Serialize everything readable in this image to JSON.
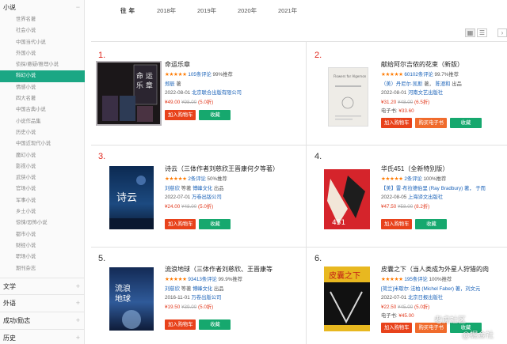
{
  "sidebar": {
    "category_open": "小说",
    "sub_items": [
      "世界名著",
      "社会小说",
      "中国当代小说",
      "外国小说",
      "侦探/悬疑/推理小说",
      "科幻小说",
      "情感小说",
      "四大名著",
      "中国古典小说",
      "小说作品集",
      "历史小说",
      "中国近现代小说",
      "魔幻小说",
      "影视小说",
      "武侠小说",
      "官场小说",
      "军事小说",
      "乡土小说",
      "惊悚/恐怖小说",
      "都市小说",
      "财经小说",
      "职场小说",
      "期刊杂志"
    ],
    "active_index": 5,
    "categories": [
      "文学",
      "外语",
      "成功/励志",
      "历史"
    ]
  },
  "years": {
    "label": "往年",
    "items": [
      "2018年",
      "2019年",
      "2020年",
      "2021年"
    ]
  },
  "view": {
    "grid_icon": "grid-view-icon",
    "list_icon": "list-view-icon"
  },
  "books": [
    {
      "rank": "1.",
      "title": "命运乐章",
      "stars": "★★★★★",
      "reviews": "105条评论",
      "recommend": "99%推荐",
      "author": "郑辰",
      "author_role": "著",
      "date": "2022-08-01",
      "publisher": "北京联合出版有限公司",
      "price": "¥49.00",
      "orig": "¥98.00",
      "discount": "(5.0折)",
      "ebook": "",
      "buttons": [
        "加入购物车",
        "",
        "收藏"
      ]
    },
    {
      "rank": "2.",
      "title": "献给阿尔吉侬的花束（新版）",
      "stars": "★★★★★",
      "reviews": "60102条评论",
      "recommend": "99.7%推荐",
      "author": "（美）丹尼尔·凯斯",
      "author_role": "著，",
      "translator": "陈澄和",
      "translator_role": "出品",
      "date": "2022-08-01",
      "publisher": "河南文艺出版社",
      "price": "¥31.20",
      "orig": "¥48.00",
      "discount": "(6.5折)",
      "ebook_label": "电子书:",
      "ebook": "¥33.60",
      "buttons": [
        "加入购物车",
        "购买电子书",
        "收藏"
      ]
    },
    {
      "rank": "3.",
      "title": "诗云（三体作者刘慈欣王晋康何夕等著）",
      "stars": "★★★★★",
      "reviews": "2条评论",
      "recommend": "50%推荐",
      "author": "刘慈欣",
      "author_role": "等著",
      "translator": "博峰文化",
      "translator_role": "出品",
      "date": "2022-07-01",
      "publisher": "万卷出版公司",
      "price": "¥24.00",
      "orig": "¥48.00",
      "discount": "(5.0折)",
      "ebook": "",
      "buttons": [
        "加入购物车",
        "",
        "收藏"
      ]
    },
    {
      "rank": "4.",
      "title": "华氏451（全新特别版）",
      "stars": "★★★★★",
      "reviews": "2条评论",
      "recommend": "100%推荐",
      "author": "【美】雷·布拉德伯里 (Ray Bradbury) 著，",
      "author_role": "于而",
      "date": "2022-08-05",
      "publisher": "上海译文出版社",
      "price": "¥47.50",
      "orig": "¥58.00",
      "discount": "(8.2折)",
      "ebook": "",
      "buttons": [
        "加入购物车",
        "",
        "收藏"
      ]
    },
    {
      "rank": "5.",
      "title": "流浪地球（三体作者刘慈欣、王晋康等",
      "stars": "★★★★★",
      "reviews": "93413条评论",
      "recommend": "99.9%推荐",
      "author": "刘慈欣",
      "author_role": "等著",
      "translator": "博峰文化",
      "translator_role": "出品",
      "date": "2016-11-01",
      "publisher": "万卷出版公司",
      "price": "¥19.50",
      "orig": "¥39.00",
      "discount": "(5.0折)",
      "ebook": "",
      "buttons": [
        "加入购物车",
        "",
        "收藏"
      ]
    },
    {
      "rank": "6.",
      "title": "皮囊之下（当人类成为外星人狩猎的肉",
      "stars": "★★★★★",
      "reviews": "195条评论",
      "recommend": "100%推荐",
      "author": "[荷兰]米歇尔·法柏 (Michel Faber) 著，刘文元",
      "author_role": "",
      "date": "2022-07-01",
      "publisher": "北京日报出版社",
      "price": "¥22.50",
      "orig": "¥45.00",
      "discount": "(5.0折)",
      "ebook_label": "电子书:",
      "ebook": "¥45.00",
      "buttons": [
        "加入购物车",
        "购买电子书",
        "收藏"
      ]
    }
  ],
  "watermark": {
    "line1": "老虎社区",
    "line2": "@掘金社"
  },
  "colors": {
    "accent": "#1ba784",
    "rank_red": "#e0281e",
    "price": "#e23a1e",
    "cart": "#e8421b",
    "fav": "#16a86e",
    "star": "#ff7a00"
  }
}
